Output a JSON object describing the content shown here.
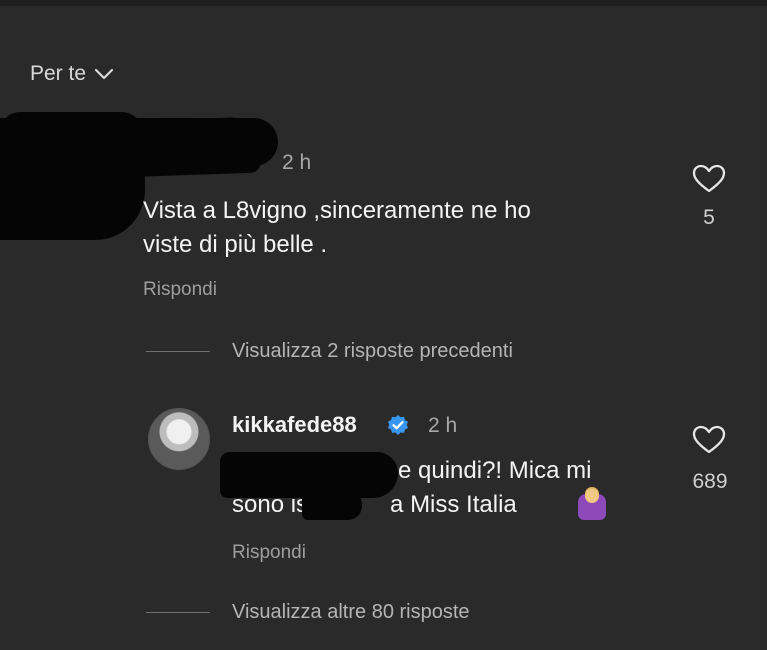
{
  "header": {
    "sort_label": "Per te"
  },
  "comment_1": {
    "time": "2 h",
    "text_line_1": "Vista a L8vigno ,sinceramente ne ho",
    "text_line_2": "viste di più  belle .",
    "reply_label": "Rispondi",
    "likes": "5"
  },
  "thread": {
    "previous_replies_label": "Visualizza 2 risposte precedenti"
  },
  "comment_2": {
    "username": "kikkafede88",
    "time": "2 h",
    "text_line_1_visible": "e quindi?! Mica mi",
    "text_line_2_visible_a": "sono isc",
    "text_line_2_visible_b": "a Miss Italia",
    "reply_label": "Rispondi",
    "likes": "689",
    "emoji": "woman-shrugging-icon"
  },
  "footer": {
    "more_replies_label": "Visualizza altre 80 risposte"
  }
}
